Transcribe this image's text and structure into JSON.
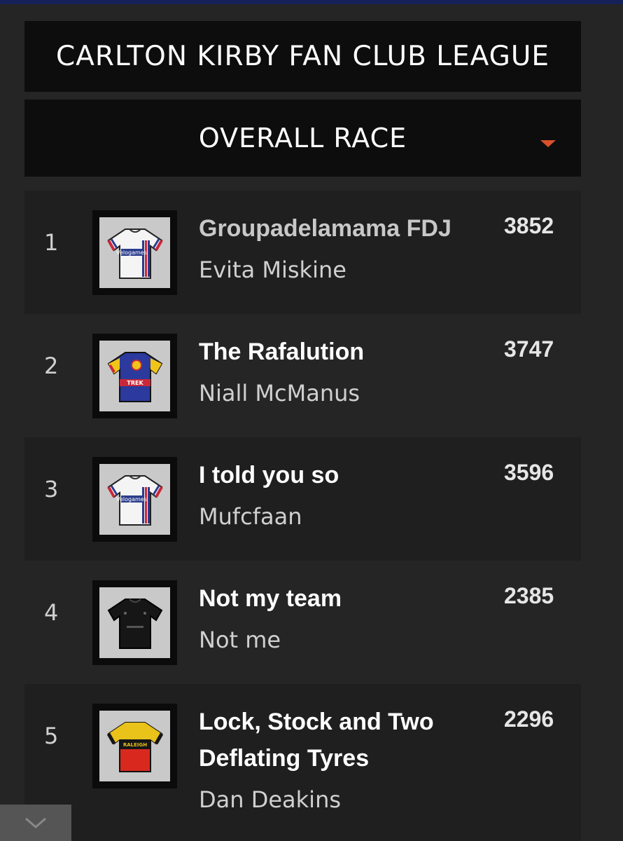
{
  "league": {
    "title": "CARLTON KIRBY FAN CLUB LEAGUE"
  },
  "race_selector": {
    "selected": "OVERALL RACE",
    "icon": "dropdown-caret-icon",
    "accent": "#d9512c"
  },
  "standings": [
    {
      "rank": "1",
      "team": "Groupadelamama FDJ",
      "owner": "Evita Miskine",
      "points": "3852",
      "jersey": "velogames-white-jersey-icon"
    },
    {
      "rank": "2",
      "team": "The Rafalution",
      "owner": "Niall McManus",
      "points": "3747",
      "jersey": "trek-lidl-jersey-icon"
    },
    {
      "rank": "3",
      "team": "I told you so",
      "owner": "Mufcfaan",
      "points": "3596",
      "jersey": "velogames-white-jersey-icon"
    },
    {
      "rank": "4",
      "team": "Not my team",
      "owner": "Not me",
      "points": "2385",
      "jersey": "black-jersey-icon"
    },
    {
      "rank": "5",
      "team": "Lock, Stock and Two Deflating Tyres",
      "owner": "Dan Deakins",
      "points": "2296",
      "jersey": "raleigh-jersey-icon"
    }
  ],
  "jersey_text": {
    "velogames": "Velogames",
    "trek": "TREK",
    "raleigh": "RALEIGH"
  },
  "scroll_button": {
    "icon": "chevron-down-icon"
  }
}
